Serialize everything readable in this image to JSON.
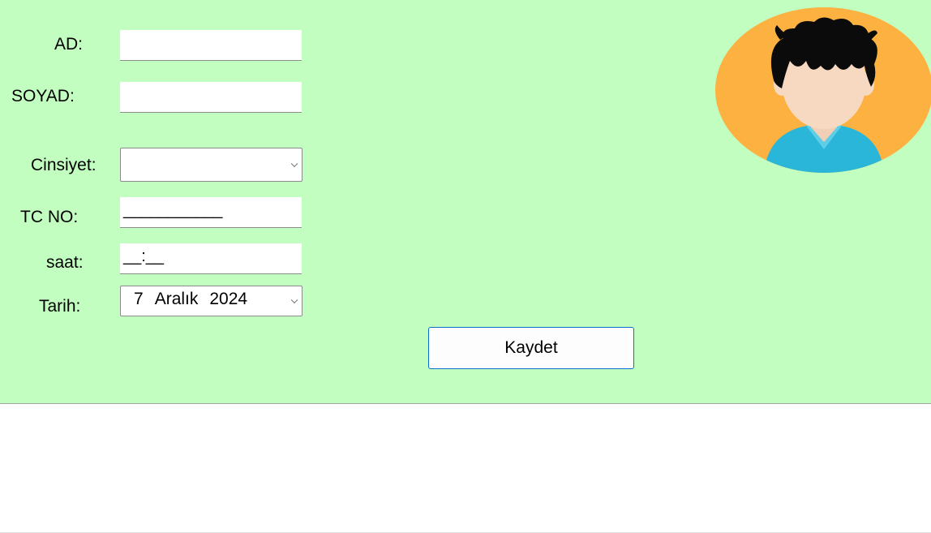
{
  "form": {
    "ad_label": "AD:",
    "ad_value": "",
    "soyad_label": "SOYAD:",
    "soyad_value": "",
    "cinsiyet_label": "Cinsiyet:",
    "cinsiyet_value": "",
    "tcno_label": "TC NO:",
    "tcno_mask": "___________",
    "saat_label": "saat:",
    "saat_mask": "__:__",
    "tarih_label": "Tarih:",
    "tarih": {
      "day": "7",
      "month": "Aralık",
      "year": "2024"
    }
  },
  "actions": {
    "save_label": "Kaydet"
  },
  "avatar": {
    "icon": "user-avatar-icon"
  },
  "colors": {
    "panel_bg": "#c2fec0",
    "avatar_bg": "#fdb140",
    "button_border": "#0a6ed1"
  }
}
